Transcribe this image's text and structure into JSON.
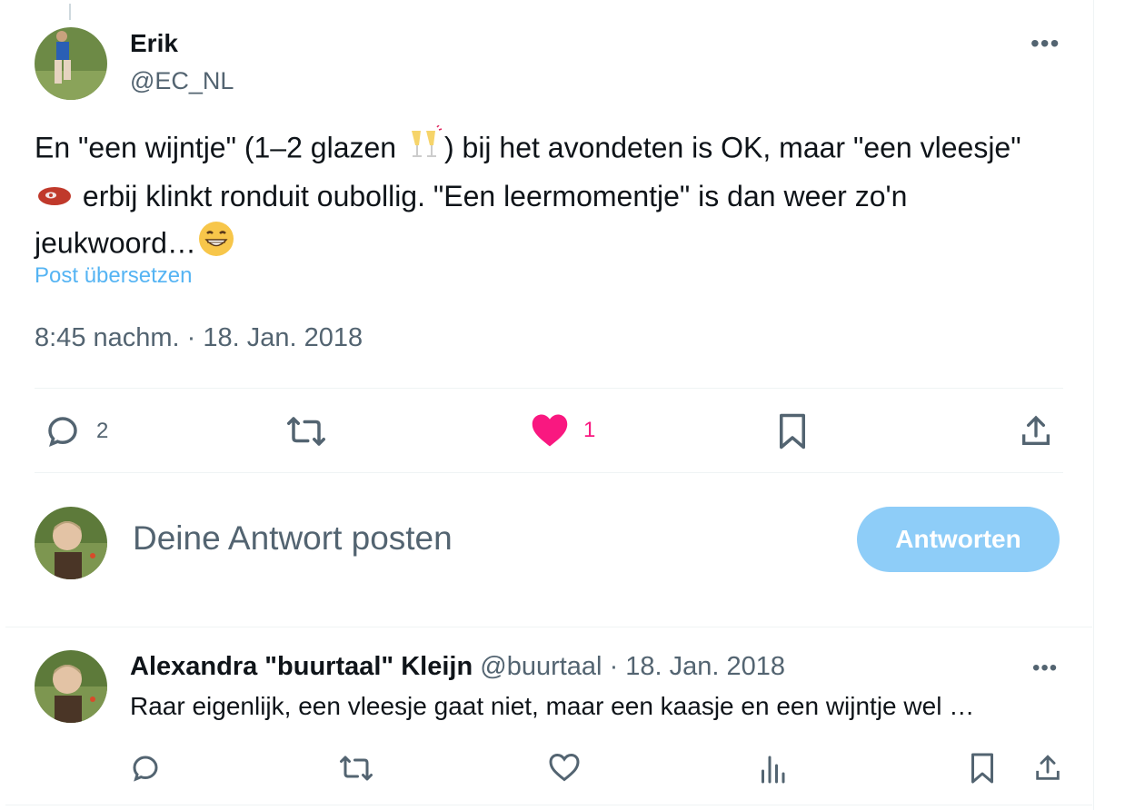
{
  "tweet": {
    "author_name": "Erik",
    "author_handle": "@EC_NL",
    "text_segments": [
      "En \"een wijntje\" (1–2 glazen ",
      ") bij het avondeten is OK, maar \"een vleesje\" ",
      " erbij klinkt ronduit oubollig. \"Een leermomentje\" is dan weer zo'n jeukwoord…"
    ],
    "emojis": [
      "clinking-glasses-icon",
      "steak-icon",
      "grinning-face-icon"
    ],
    "translate_label": "Post übersetzen",
    "timestamp": "8:45 nachm. · 18. Jan. 2018",
    "actions": {
      "reply_count": "2",
      "like_count": "1"
    }
  },
  "composer": {
    "placeholder": "Deine Antwort posten",
    "submit_label": "Antworten"
  },
  "reply": {
    "author_name": "Alexandra \"buurtaal\" Kleijn",
    "author_handle": "@buurtaal",
    "date": "· 18. Jan. 2018",
    "text": "Raar eigenlijk, een vleesje gaat niet, maar een kaasje en een wijntje wel …"
  },
  "colors": {
    "accent": "#1d9bf0",
    "like": "#f91880",
    "muted": "#536471",
    "button_disabled": "#8ecdf8"
  }
}
